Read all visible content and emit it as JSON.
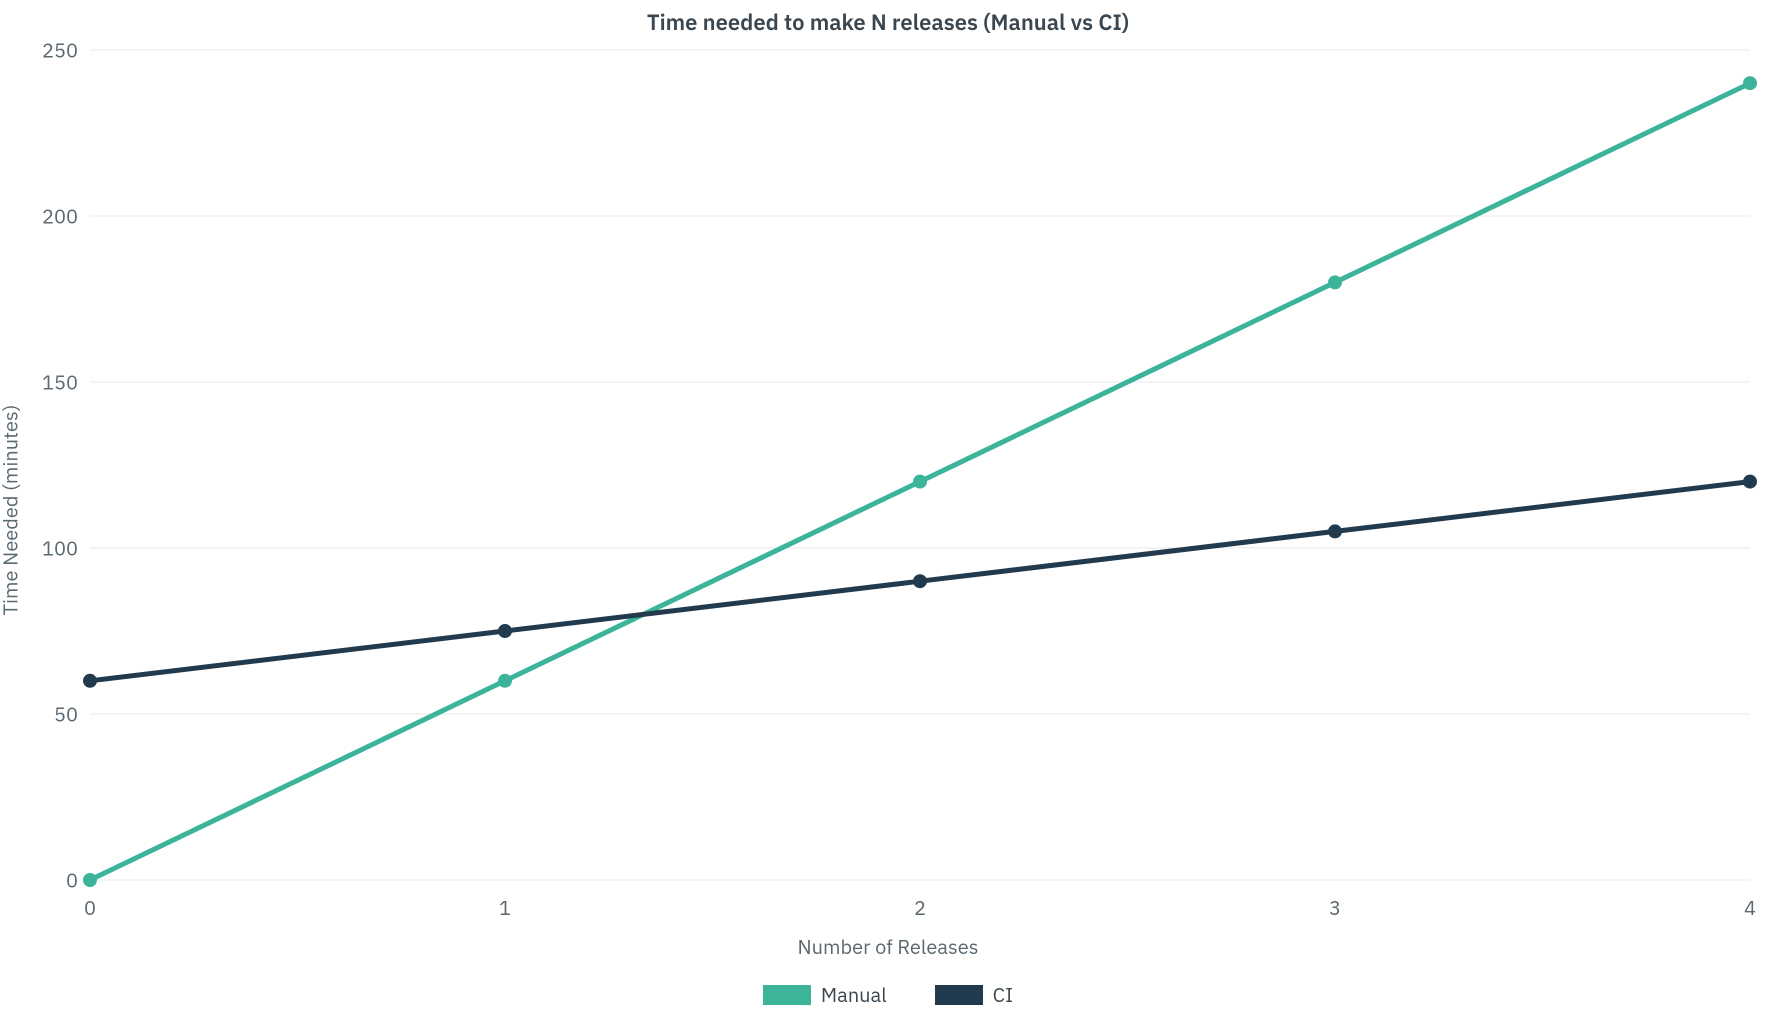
{
  "chart_data": {
    "type": "line",
    "title": "Time needed to make N releases (Manual vs CI)",
    "xlabel": "Number of Releases",
    "ylabel": "Time Needed (minutes)",
    "x": [
      0,
      1,
      2,
      3,
      4
    ],
    "xlim": [
      0,
      4
    ],
    "ylim": [
      0,
      250
    ],
    "yticks": [
      0,
      50,
      100,
      150,
      200,
      250
    ],
    "xticks": [
      0,
      1,
      2,
      3,
      4
    ],
    "series": [
      {
        "name": "Manual",
        "color": "#3cb499",
        "values": [
          0,
          60,
          120,
          180,
          240
        ]
      },
      {
        "name": "CI",
        "color": "#223a4e",
        "values": [
          60,
          75,
          90,
          105,
          120
        ]
      }
    ],
    "legend_position": "bottom",
    "grid": "horizontal"
  }
}
